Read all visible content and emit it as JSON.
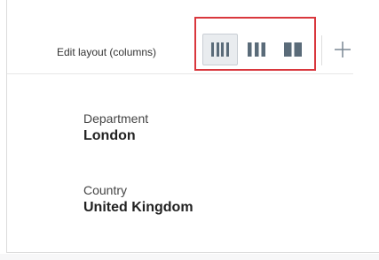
{
  "toolbar": {
    "edit_layout_label": "Edit layout (columns)",
    "layout_options": [
      {
        "icon": "four-columns-icon",
        "columns": 4,
        "selected": true
      },
      {
        "icon": "three-columns-icon",
        "columns": 3,
        "selected": false
      },
      {
        "icon": "two-columns-icon",
        "columns": 2,
        "selected": false
      }
    ],
    "add_icon": "plus-icon"
  },
  "fields": [
    {
      "label": "Department",
      "value": "London"
    },
    {
      "label": "Country",
      "value": "United Kingdom"
    }
  ],
  "colors": {
    "highlight_border": "#d9373d",
    "icon_fill": "#5a6b79",
    "selected_background": "#e9ecef"
  }
}
